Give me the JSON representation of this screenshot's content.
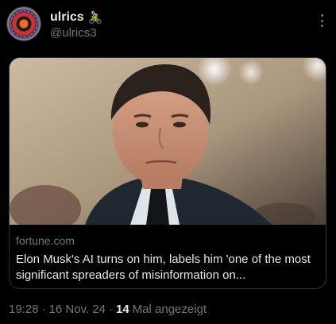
{
  "author": {
    "display_name": "ulrics",
    "emoji": "🚴",
    "handle": "@ulrics3"
  },
  "menu_icon": "more-vertical-icon",
  "link_card": {
    "domain": "fortune.com",
    "title": "Elon Musk's AI turns on him, labels him 'one of the most significant spreaders of misinformation on..."
  },
  "meta": {
    "time": "19:28",
    "sep1": "·",
    "date": "16 Nov. 24",
    "sep2": "·",
    "view_count": "14",
    "views_label": "Mal angezeigt"
  },
  "colors": {
    "background": "#000000",
    "primary_text": "#e7e9ea",
    "secondary_text": "#71767b",
    "border": "#2f3336"
  }
}
